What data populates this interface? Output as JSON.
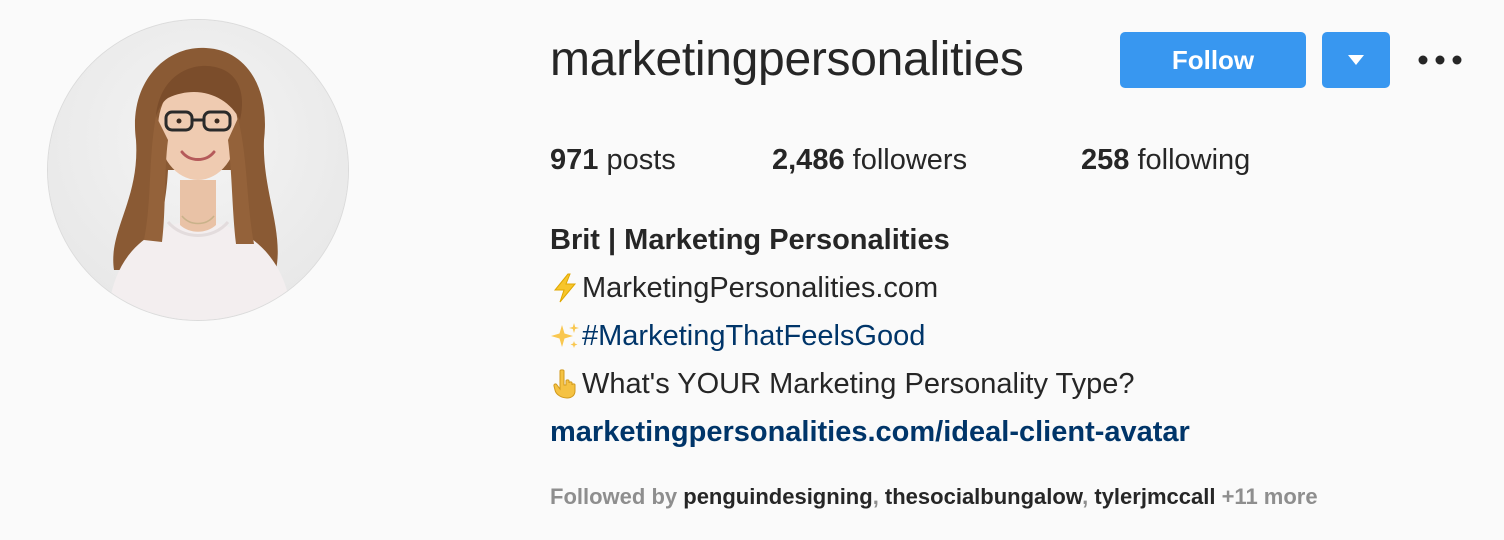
{
  "profile": {
    "username": "marketingpersonalities",
    "follow_label": "Follow"
  },
  "stats": {
    "posts_count": "971",
    "posts_label": "posts",
    "followers_count": "2,486",
    "followers_label": "followers",
    "following_count": "258",
    "following_label": "following"
  },
  "bio": {
    "name": "Brit | Marketing Personalities",
    "line1_text": "MarketingPersonalities.com",
    "line2_hashtag": "#MarketingThatFeelsGood",
    "line3_text": "What's YOUR Marketing Personality Type?",
    "link": "marketingpersonalities.com/ideal-client-avatar"
  },
  "followed_by": {
    "prefix": "Followed by",
    "users": [
      "penguindesigning",
      "thesocialbungalow",
      "tylerjmccall"
    ],
    "more": "+11 more"
  },
  "icons": {
    "line1": "lightning-bolt-icon",
    "line2": "sparkles-icon",
    "line3": "pointing-down-icon",
    "dropdown": "caret-down-icon",
    "more": "more-options-icon"
  },
  "colors": {
    "accent": "#3897f0",
    "link": "#003569",
    "text": "#262626",
    "muted": "#8e8e8e",
    "background": "#fafafa"
  }
}
